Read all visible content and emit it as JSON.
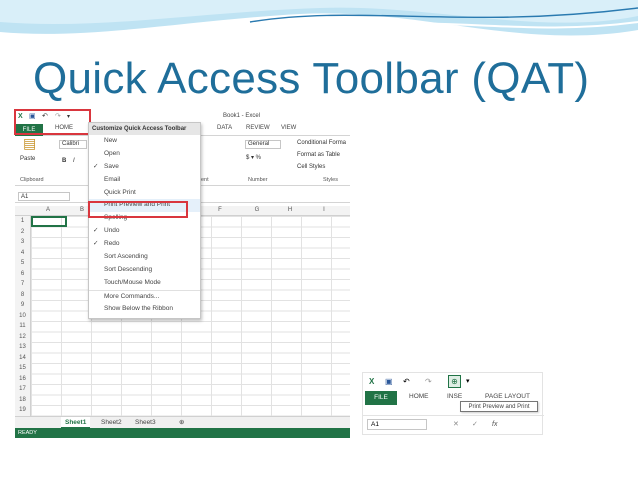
{
  "slide": {
    "title": "Quick Access Toolbar (QAT)"
  },
  "colors": {
    "excel_green": "#217346",
    "highlight_red": "#d9363e",
    "title_blue": "#1f6e9a"
  },
  "excel": {
    "window_title": "Book1 - Excel",
    "tabs": {
      "file": "FILE",
      "home": "HOME",
      "data": "DATA",
      "review": "REVIEW",
      "view": "VIEW"
    },
    "ribbon": {
      "paste": "Paste",
      "font_name": "Calibri",
      "bold": "B",
      "italic": "I",
      "clipboard_group": "Clipboard",
      "number_format": "General",
      "number_group": "Number",
      "conditional_formatting": "Conditional Forma",
      "format_as_table": "Format as Table",
      "cell_styles": "Cell Styles",
      "styles_group": "Styles",
      "alignment_group_tail": "ent"
    },
    "name_box": "A1",
    "columns": [
      "A",
      "B",
      "F",
      "G",
      "H",
      "I"
    ],
    "rows": [
      "1",
      "2",
      "3",
      "4",
      "5",
      "6",
      "7",
      "8",
      "9",
      "10",
      "11",
      "12",
      "13",
      "14",
      "15",
      "16",
      "17",
      "18",
      "19"
    ],
    "sheets": [
      "Sheet1",
      "Sheet2",
      "Sheet3"
    ],
    "status": "READY"
  },
  "qat_menu": {
    "header": "Customize Quick Access Toolbar",
    "items": [
      {
        "label": "New",
        "checked": false
      },
      {
        "label": "Open",
        "checked": false
      },
      {
        "label": "Save",
        "checked": true
      },
      {
        "label": "Email",
        "checked": false
      },
      {
        "label": "Quick Print",
        "checked": false
      },
      {
        "label": "Print Preview and Print",
        "checked": false
      },
      {
        "label": "Spelling",
        "checked": false
      },
      {
        "label": "Undo",
        "checked": true
      },
      {
        "label": "Redo",
        "checked": true
      },
      {
        "label": "Sort Ascending",
        "checked": false
      },
      {
        "label": "Sort Descending",
        "checked": false
      },
      {
        "label": "Touch/Mouse Mode",
        "checked": false
      },
      {
        "label": "More Commands...",
        "checked": false
      },
      {
        "label": "Show Below the Ribbon",
        "checked": false
      }
    ],
    "highlighted_index": 5
  },
  "small_shot": {
    "tabs": {
      "file": "FILE",
      "home": "HOME",
      "insert": "INSE",
      "page_layout": "PAGE LAYOUT"
    },
    "tooltip": "Print Preview and Print",
    "name_box": "A1"
  },
  "icons": [
    "excel-logo-icon",
    "save-icon",
    "undo-icon",
    "redo-icon",
    "print-preview-icon",
    "customize-dropdown-icon",
    "paste-icon",
    "check-icon",
    "fx-icon",
    "cancel-icon",
    "enter-icon",
    "add-sheet-icon"
  ]
}
